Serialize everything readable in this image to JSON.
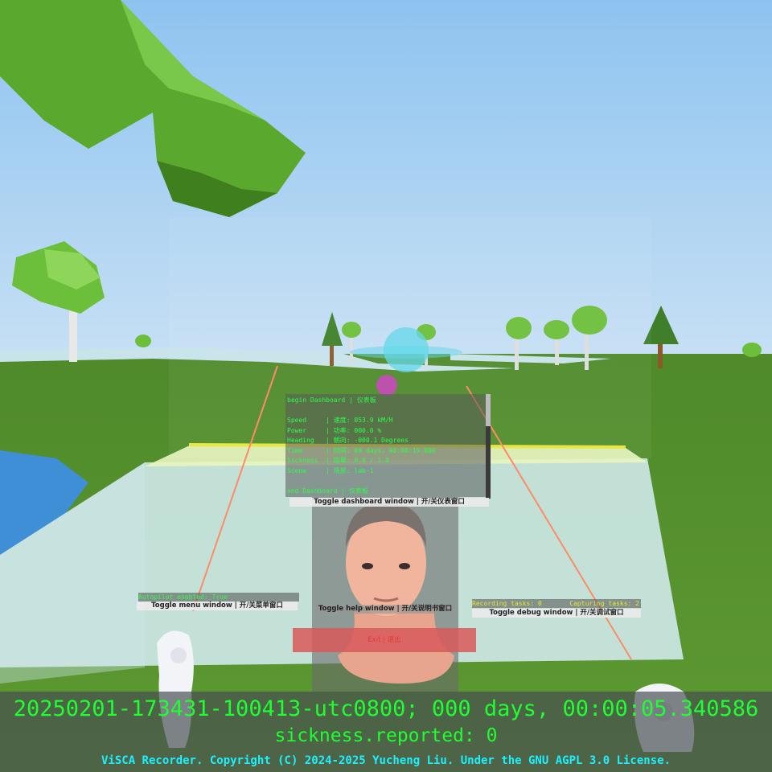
{
  "dashboard": {
    "begin": "begin Dashboard | 仪表板",
    "rows": [
      "Speed     | 速度: 053.9 kM/H",
      "Power     | 功率: 000.0 %",
      "Heading   | 朝向: -000.1 Degrees",
      "Time      | 时间: 00 days, 00:00:19.800",
      "Sickness  | 眩晕: 0.0 / 1.0",
      "Scene     | 场景: lab-1"
    ],
    "end": "end Dashboard | 仪表板"
  },
  "buttons": {
    "toggle_dashboard": "Toggle dashboard window | 开/关仪表窗口",
    "toggle_menu": "Toggle menu window | 开/关菜单窗口",
    "toggle_help": "Toggle help window | 开/关说明书窗口",
    "toggle_debug": "Toggle debug window | 开/关调试窗口",
    "exit": "Exit | 退出"
  },
  "status": {
    "autopilot": "Autopilot enabled: True",
    "recording_tasks": "Recording tasks: 0",
    "capturing_tasks": "Capturing tasks: 2"
  },
  "footer": {
    "timestamp": "20250201-173431-100413-utc0800; 000 days, 00:00:05.340586",
    "sickness": "sickness.reported: 0",
    "copyright": "ViSCA Recorder. Copyright (C) 2024-2025 Yucheng Liu. Under the GNU AGPL 3.0 License."
  },
  "colors": {
    "hud_green": "#1eff32",
    "copyright_cyan": "#1ef0ff",
    "sky": "#9cc8ef",
    "grass": "#4e8a2a"
  }
}
